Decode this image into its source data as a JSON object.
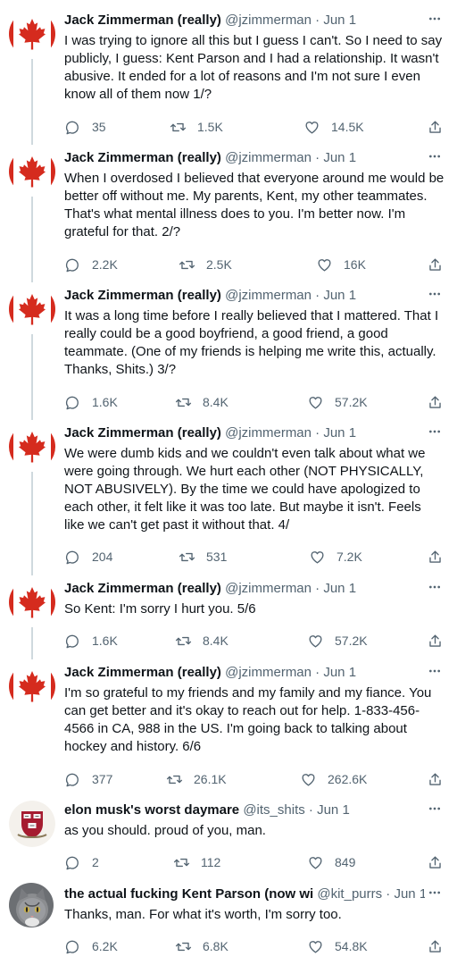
{
  "colors": {
    "text": "#0f1419",
    "secondary": "#536471",
    "line": "#cfd9de",
    "maple": "#d52b1e"
  },
  "tweets": [
    {
      "name": "Jack Zimmerman (really)",
      "handle": "@jzimmerman",
      "sep": "·",
      "date": "Jun 1",
      "avatar_icon": "canada-flag-maple-leaf",
      "text": "I was trying to ignore all this but I guess I can't. So I need to say publicly, I guess: Kent Parson and I had a relationship. It wasn't abusive. It ended for a lot of reasons and I'm not sure I even know all of them now 1/?",
      "replies": "35",
      "retweets": "1.5K",
      "likes": "14.5K"
    },
    {
      "name": "Jack Zimmerman (really)",
      "handle": "@jzimmerman",
      "sep": "·",
      "date": "Jun 1",
      "avatar_icon": "canada-flag-maple-leaf",
      "text": "When I overdosed I believed that everyone around me would be better off without me. My parents, Kent, my other teammates. That's what mental illness does to you. I'm better now. I'm grateful for that. 2/?",
      "replies": "2.2K",
      "retweets": "2.5K",
      "likes": "16K"
    },
    {
      "name": "Jack Zimmerman (really)",
      "handle": "@jzimmerman",
      "sep": "·",
      "date": "Jun 1",
      "avatar_icon": "canada-flag-maple-leaf",
      "text": "It was a long time before I really believed that I mattered. That I really could be a good boyfriend, a good friend, a good teammate. (One of my friends is helping me write this, actually. Thanks, Shits.) 3/?",
      "replies": "1.6K",
      "retweets": "8.4K",
      "likes": "57.2K"
    },
    {
      "name": "Jack Zimmerman (really)",
      "handle": "@jzimmerman",
      "sep": "·",
      "date": "Jun 1",
      "avatar_icon": "canada-flag-maple-leaf",
      "text": "We were dumb kids and we couldn't even talk about what we were going through. We hurt each other (NOT PHYSICALLY, NOT ABUSIVELY). By the time we could have apologized to each other, it felt like it was too late. But maybe it isn't. Feels like we can't get past it without that. 4/",
      "replies": "204",
      "retweets": "531",
      "likes": "7.2K"
    },
    {
      "name": "Jack Zimmerman (really)",
      "handle": "@jzimmerman",
      "sep": "·",
      "date": "Jun 1",
      "avatar_icon": "canada-flag-maple-leaf",
      "text": "So Kent: I'm sorry I hurt you. 5/6",
      "replies": "1.6K",
      "retweets": "8.4K",
      "likes": "57.2K"
    },
    {
      "name": "Jack Zimmerman (really)",
      "handle": "@jzimmerman",
      "sep": "·",
      "date": "Jun 1",
      "avatar_icon": "canada-flag-maple-leaf",
      "text": "I'm so grateful to my friends and my family and my fiance. You can get better and it's okay to reach out for help. 1-833-456-4566 in CA, 988 in the US. I'm going back to talking about hockey and history. 6/6",
      "replies": "377",
      "retweets": "26.1K",
      "likes": "262.6K"
    },
    {
      "name": "elon musk's worst daymare",
      "handle": "@its_shits",
      "sep": "·",
      "date": "Jun 1",
      "avatar_icon": "university-crest",
      "text": "as you should. proud of you, man.",
      "replies": "2",
      "retweets": "112",
      "likes": "849"
    },
    {
      "name": "the actual fucking Kent Parson (now wi",
      "handle": "@kit_purrs",
      "sep": "·",
      "date": "Jun 1",
      "avatar_icon": "cat-photo",
      "text": "Thanks, man. For what it's worth, I'm sorry too.",
      "replies": "6.2K",
      "retweets": "6.8K",
      "likes": "54.8K"
    }
  ]
}
